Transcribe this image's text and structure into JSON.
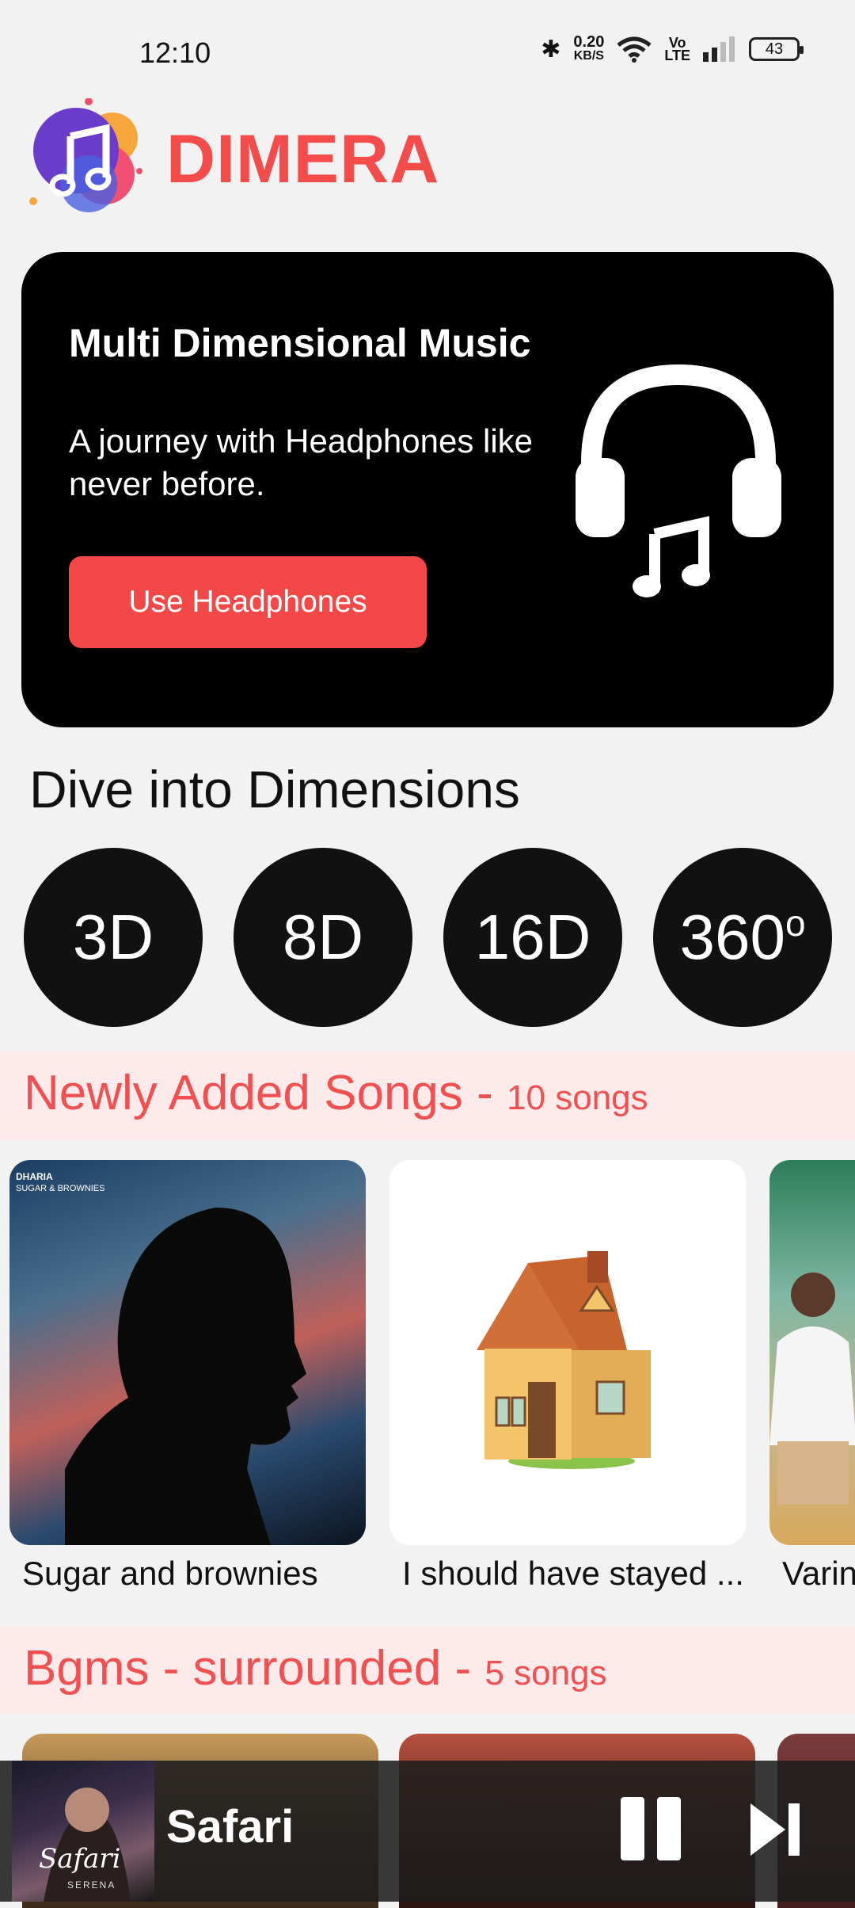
{
  "status": {
    "time": "12:10",
    "net_speed_value": "0.20",
    "net_speed_unit": "KB/S",
    "volte_top": "Vo",
    "volte_bottom": "LTE",
    "battery": "43"
  },
  "app": {
    "title": "DIMERA"
  },
  "hero": {
    "title": "Multi Dimensional Music",
    "subtitle": "A journey with Headphones like never before.",
    "button_label": "Use Headphones"
  },
  "dimensions": {
    "title": "Dive into Dimensions",
    "items": [
      {
        "label": "3D"
      },
      {
        "label": "8D"
      },
      {
        "label": "16D"
      },
      {
        "label": "360",
        "sup": "o"
      }
    ]
  },
  "sections": [
    {
      "title": "Newly Added Songs",
      "separator": " - ",
      "count": "10 songs",
      "songs": [
        {
          "title": "Sugar and brownies",
          "cover_artist": "DHARIA",
          "cover_subtitle": "SUGAR & BROWNIES"
        },
        {
          "title": "I should have stayed ..."
        },
        {
          "title": "Varin"
        }
      ]
    },
    {
      "title": "Bgms - surrounded",
      "separator": " - ",
      "count": "5 songs"
    }
  ],
  "player": {
    "title": "Safari",
    "cover_text": "Safari",
    "cover_artist": "SERENA"
  },
  "colors": {
    "accent": "#f44b4b",
    "band": "#fdeaea",
    "dark": "#111111"
  }
}
